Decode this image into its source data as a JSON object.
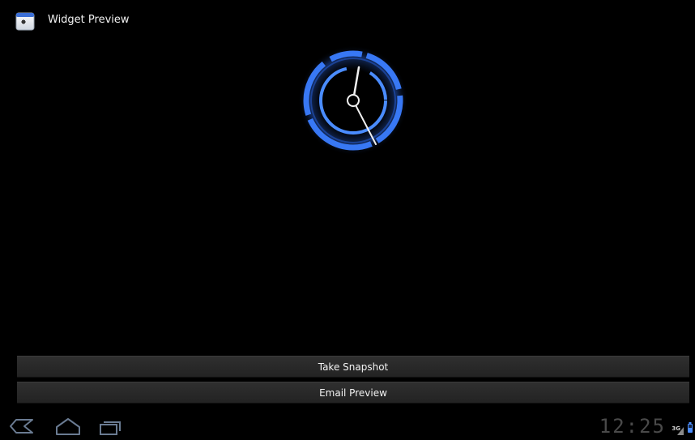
{
  "app": {
    "title": "Widget Preview",
    "icon": "widget-preview-app-icon"
  },
  "widget": {
    "type": "analog-clock",
    "accent_color": "#4a90ff"
  },
  "actions": {
    "take_snapshot_label": "Take Snapshot",
    "email_preview_label": "Email Preview"
  },
  "system_bar": {
    "nav_icons": [
      "back-icon",
      "home-icon",
      "recent-apps-icon"
    ],
    "time": "12:25",
    "network_label": "3G",
    "signal_icon": "signal-icon",
    "battery_icon": "battery-icon"
  },
  "colors": {
    "background": "#000000",
    "button_bg": "#2a2a2a",
    "clock_glow": "#3b7dff"
  }
}
